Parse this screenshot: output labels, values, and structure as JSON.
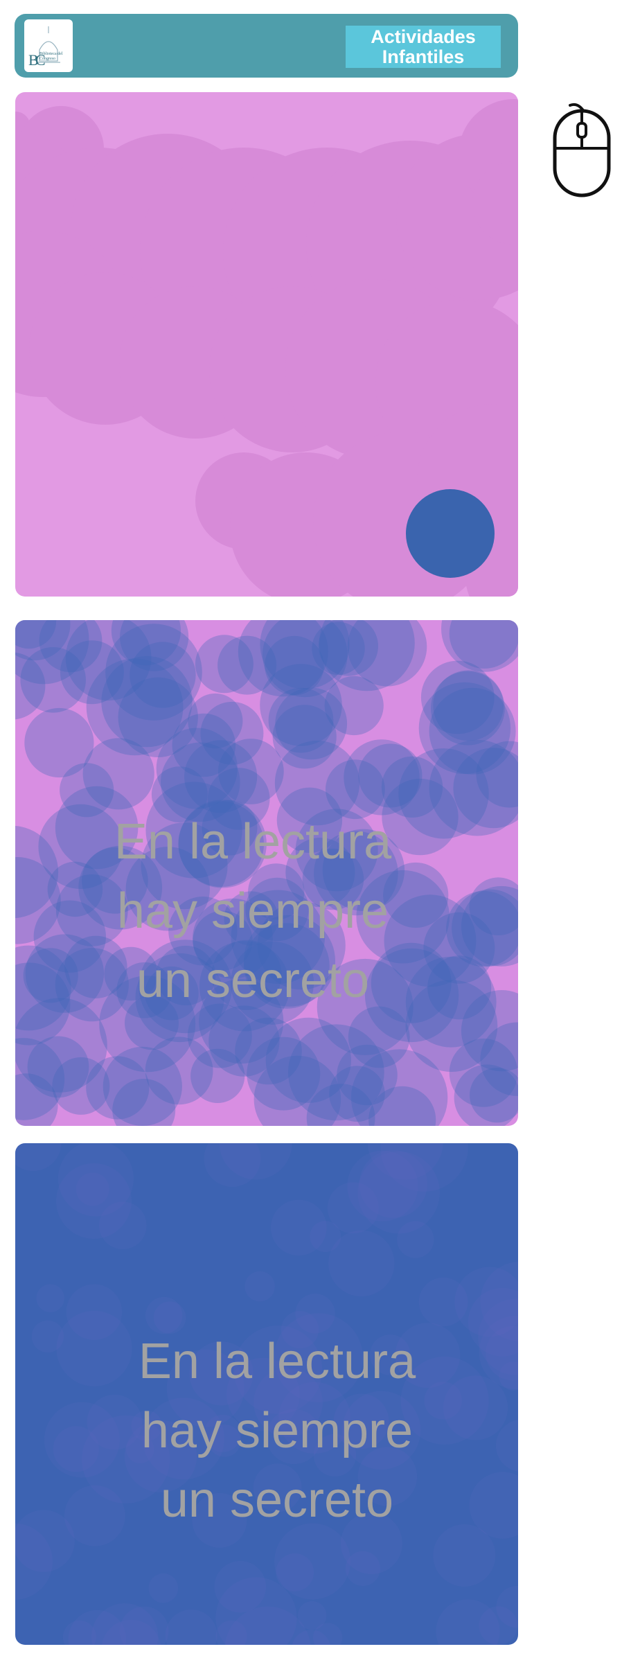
{
  "header": {
    "logo_lines": [
      "Biblioteca del",
      "Congreso"
    ],
    "activities_label": "Actividades\nInfantiles"
  },
  "panels": [
    {
      "name": "pink-blob-canvas",
      "colors": {
        "bg": "#e29ae3",
        "blob": "#d78bd8",
        "dot": "#3a64ae"
      }
    },
    {
      "name": "bubble-canvas",
      "quote": "En la lectura\nhay siempre\nun secreto",
      "colors": {
        "bg": "#d88ee2",
        "bubble": "#3f66b8"
      }
    },
    {
      "name": "blue-canvas",
      "quote": "En la lectura\nhay siempre\nun secreto",
      "colors": {
        "bg": "#3d63b2",
        "haze": "#6b6fc6"
      }
    }
  ],
  "icons": {
    "scroll_hint": "mouse-icon"
  }
}
